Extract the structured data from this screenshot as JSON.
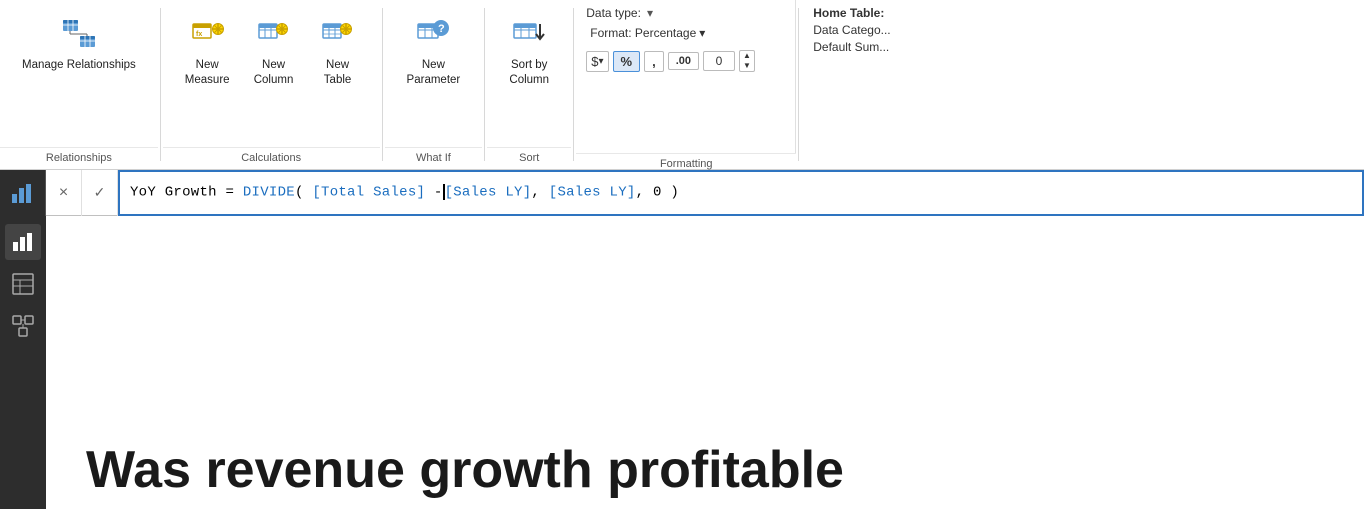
{
  "ribbon": {
    "sections": [
      {
        "id": "relationships",
        "label": "Relationships",
        "items": [
          {
            "id": "manage-relationships",
            "label": "Manage\nRelationships",
            "icon": "manage-relationships-icon"
          }
        ]
      },
      {
        "id": "calculations",
        "label": "Calculations",
        "items": [
          {
            "id": "new-measure",
            "label": "New\nMeasure",
            "icon": "new-measure-icon"
          },
          {
            "id": "new-column",
            "label": "New\nColumn",
            "icon": "new-column-icon"
          },
          {
            "id": "new-table",
            "label": "New\nTable",
            "icon": "new-table-icon"
          }
        ]
      },
      {
        "id": "what-if",
        "label": "What If",
        "items": [
          {
            "id": "new-parameter",
            "label": "New\nParameter",
            "icon": "new-parameter-icon"
          }
        ]
      },
      {
        "id": "sort",
        "label": "Sort",
        "items": [
          {
            "id": "sort-by-column",
            "label": "Sort by\nColumn",
            "icon": "sort-by-column-icon"
          }
        ]
      },
      {
        "id": "formatting",
        "label": "Formatting",
        "data_type_label": "Data type:",
        "format_label": "Format: Percentage",
        "format_dropdown_arrow": "▾",
        "currency_symbol": "$",
        "currency_arrow": "▾",
        "percent_symbol": "%",
        "comma_symbol": ",",
        "decimal_symbol": ".00",
        "decimal_value": "0"
      }
    ],
    "home_table": {
      "label": "Home Table:",
      "data_category_label": "Data Catego...",
      "default_sum_label": "Default Sum..."
    }
  },
  "formula_bar": {
    "formula_text_plain": "YoY Growth = DIVIDE( [Total Sales] - [Sales LY], [Sales LY], 0 )",
    "formula_text_parts": [
      {
        "text": "YoY Growth = ",
        "type": "plain"
      },
      {
        "text": "DIVIDE",
        "type": "function"
      },
      {
        "text": "( ",
        "type": "plain"
      },
      {
        "text": "[Total Sales]",
        "type": "ref"
      },
      {
        "text": " - ",
        "type": "plain"
      },
      {
        "text": "[Sales LY]",
        "type": "ref"
      },
      {
        "text": ", ",
        "type": "plain"
      },
      {
        "text": "[Sales LY]",
        "type": "ref"
      },
      {
        "text": ", 0 )",
        "type": "plain"
      }
    ],
    "cancel_label": "×",
    "confirm_label": "✓"
  },
  "sidebar": {
    "icons": [
      {
        "id": "report-view",
        "icon": "bar-chart-icon",
        "active": true
      },
      {
        "id": "table-view",
        "icon": "table-icon"
      },
      {
        "id": "model-view",
        "icon": "model-icon"
      }
    ]
  },
  "main": {
    "heading": "Was revenue growth profitable"
  }
}
